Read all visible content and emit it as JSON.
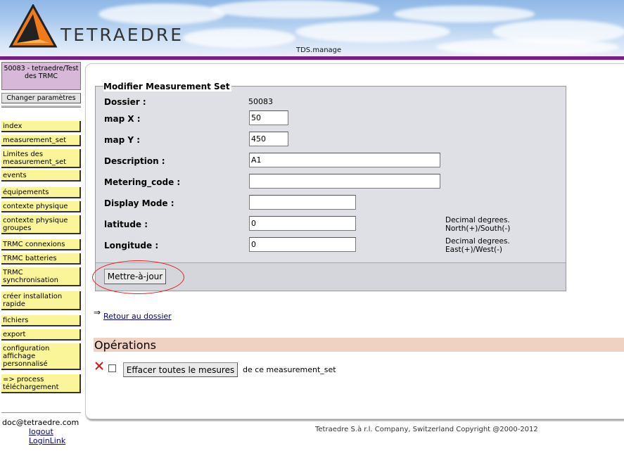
{
  "header": {
    "brand": "TETRAEDRE",
    "app_name": "TDS.manage"
  },
  "sidebar": {
    "project": "50083 - tetraedre/Test des TRMC",
    "change_params": "Changer paramètres",
    "items": [
      {
        "label": "index"
      },
      {
        "label": "measurement_set"
      },
      {
        "label": "Limites des measurement_set"
      },
      {
        "label": "events"
      },
      {
        "label": "équipements"
      },
      {
        "label": "contexte physique"
      },
      {
        "label": "contexte physique groupes"
      },
      {
        "label": "TRMC connexions"
      },
      {
        "label": "TRMC batteries"
      },
      {
        "label": "TRMC synchronisation"
      },
      {
        "label": "créer installation rapide"
      },
      {
        "label": "fichiers"
      },
      {
        "label": "export"
      },
      {
        "label": "configuration affichage personnalisé"
      },
      {
        "label": "=>   process téléchargement"
      }
    ],
    "email": "doc@tetraedre.com",
    "logout": "logout",
    "loginlink": "LoginLink"
  },
  "form": {
    "legend": "Modifier Measurement Set",
    "dossier_label": "Dossier :",
    "dossier_value": "50083",
    "mapx_label": "map X :",
    "mapx_value": "50",
    "mapy_label": "map Y :",
    "mapy_value": "450",
    "description_label": "Description :",
    "description_value": "A1",
    "metering_label": "Metering_code :",
    "metering_value": "",
    "display_label": "Display Mode :",
    "display_value": "",
    "latitude_label": "latitude :",
    "latitude_value": "0",
    "latitude_hint_1": "Decimal degrees.",
    "latitude_hint_2": "North(+)/South(-)",
    "longitude_label": "Longitude :",
    "longitude_value": "0",
    "longitude_hint_1": "Decimal degrees.",
    "longitude_hint_2": "East(+)/West(-)",
    "submit_label": "Mettre-à-jour"
  },
  "back": {
    "arrow": "⇒",
    "link_label": "Retour au dossier"
  },
  "operations": {
    "title": "Opérations",
    "delete_label": "Effacer toutes le mesures",
    "delete_suffix": "de ce measurement_set"
  },
  "footer": {
    "copyright": "Tetraedre S.à r.l. Company, Switzerland Copyright @2000-2012"
  },
  "colors": {
    "accent_bar": "#7a1c88",
    "nav_bg": "#fbf59a",
    "project_bg": "#d7b8d8",
    "operations_bar": "#f0d2c2",
    "highlight": "#e02020"
  },
  "icons": {
    "logo": "tetraedre-logo-icon",
    "delete": "red-x-icon",
    "back": "double-arrow-right-icon"
  }
}
